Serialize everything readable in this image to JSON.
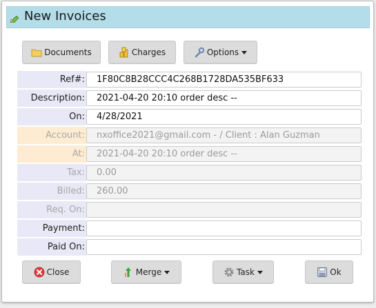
{
  "window": {
    "title": "New Invoices"
  },
  "toolbar": {
    "documents_label": "Documents",
    "charges_label": "Charges",
    "options_label": "Options"
  },
  "fields": {
    "ref": {
      "label": "Ref#:",
      "value": "1F80C8B28CCC4C268B1728DA535BF633"
    },
    "description": {
      "label": "Description:",
      "value": "2021-04-20 20:10 order desc --"
    },
    "on": {
      "label": "On:",
      "value": "4/28/2021"
    },
    "account": {
      "label": "Account:",
      "value": "nxoffice2021@gmail.com -  / Client : Alan Guzman"
    },
    "at": {
      "label": "At:",
      "value": "2021-04-20 20:10 order desc --"
    },
    "tax": {
      "label": "Tax:",
      "value": "0.00"
    },
    "billed": {
      "label": "Billed:",
      "value": "260.00"
    },
    "req_on": {
      "label": "Req. On:",
      "value": ""
    },
    "payment": {
      "label": "Payment:",
      "value": ""
    },
    "paid_on": {
      "label": "Paid On:",
      "value": ""
    }
  },
  "footer": {
    "close_label": "Close",
    "merge_label": "Merge",
    "task_label": "Task",
    "ok_label": "Ok"
  },
  "colors": {
    "titlebar": "#b3dde8",
    "label_bg": "#e8e8f6",
    "label_readonly_bg": "#fdecd1",
    "button_bg": "#dcdcdc"
  }
}
